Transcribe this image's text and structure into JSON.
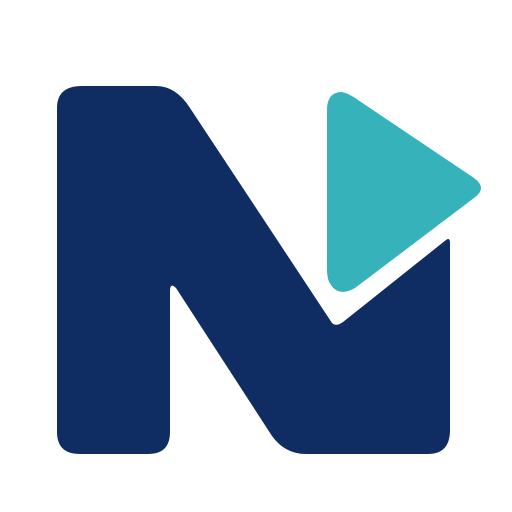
{
  "logo": {
    "name": "N play logo",
    "icon": "n-play-logo-icon",
    "colors": {
      "letter_n": "#0f2d62",
      "play_triangle": "#36b2bb",
      "background": "#ffffff"
    }
  }
}
